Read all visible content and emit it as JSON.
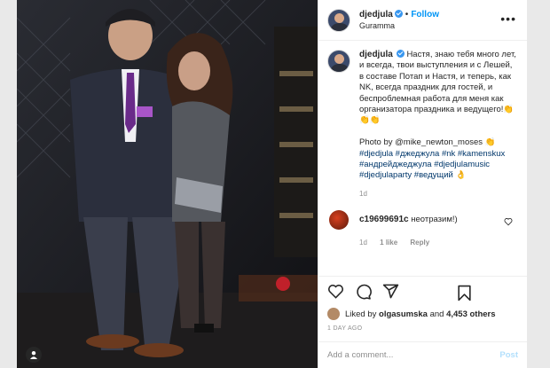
{
  "post": {
    "username": "djedjula",
    "follow_label": "Follow",
    "location": "Guramma",
    "more_icon": "more-icon",
    "caption_text": "Настя, знаю тебя много лет, и всегда, твои выступления и с Лешей, в составе Потап и Настя, и теперь, как NK, всегда праздник для гостей, и беспроблемная работа для меня как организатора праздника и ведущего!👏👏👏",
    "caption_credit": "Photo by @mike_newton_moses 👏",
    "caption_tags": "#djedjula #джеджула #nk #kamenskux #андрейджеджула #djedjulamusic #djedjulaparty #ведущий 👌",
    "caption_time": "1d",
    "comment": {
      "username": "c19699691c",
      "text": "неотразим!)",
      "time": "1d",
      "likes": "1 like",
      "reply": "Reply"
    },
    "liked_by_prefix": "Liked by",
    "liked_by_user": "olgasumska",
    "liked_by_and": "and",
    "liked_by_others": "4,453 others",
    "time_ago": "1 DAY AGO",
    "add_comment_placeholder": "Add a comment...",
    "post_label": "Post"
  },
  "colors": {
    "accent": "#0095f6",
    "hashtag": "#00376b",
    "muted": "#8e8e8e"
  }
}
